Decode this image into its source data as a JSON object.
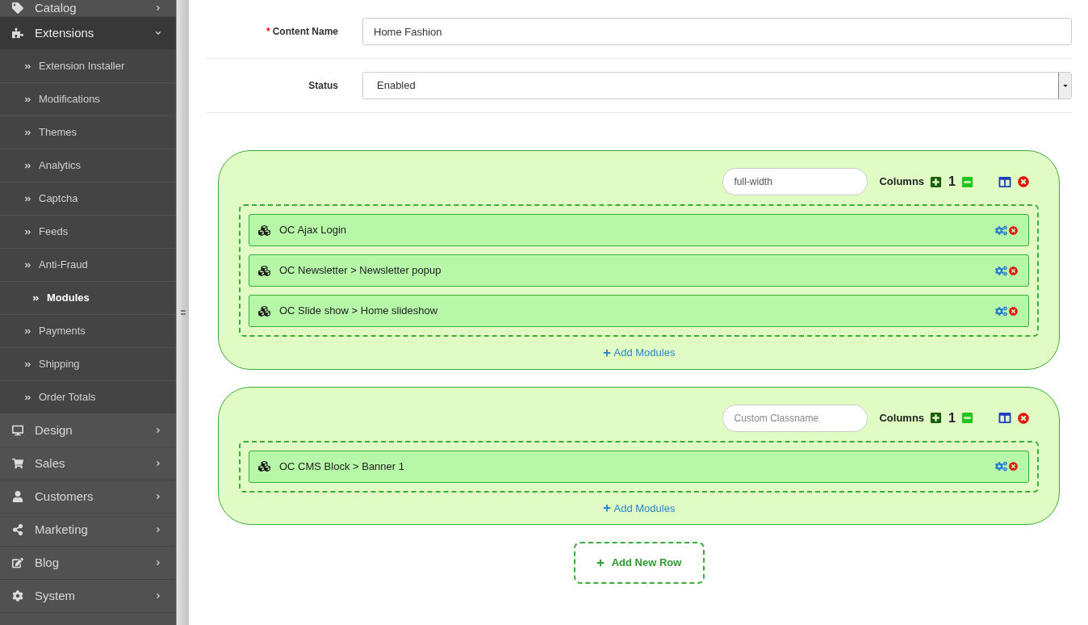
{
  "sidebar": {
    "items": [
      {
        "label": "Catalog",
        "expanded": false
      },
      {
        "label": "Extensions",
        "expanded": true,
        "children": [
          {
            "label": "Extension Installer",
            "selected": false
          },
          {
            "label": "Modifications",
            "selected": false
          },
          {
            "label": "Themes",
            "selected": false
          },
          {
            "label": "Analytics",
            "selected": false
          },
          {
            "label": "Captcha",
            "selected": false
          },
          {
            "label": "Feeds",
            "selected": false
          },
          {
            "label": "Anti-Fraud",
            "selected": false
          },
          {
            "label": "Modules",
            "selected": true
          },
          {
            "label": "Payments",
            "selected": false
          },
          {
            "label": "Shipping",
            "selected": false
          },
          {
            "label": "Order Totals",
            "selected": false
          }
        ]
      },
      {
        "label": "Design",
        "expanded": false
      },
      {
        "label": "Sales",
        "expanded": false
      },
      {
        "label": "Customers",
        "expanded": false
      },
      {
        "label": "Marketing",
        "expanded": false
      },
      {
        "label": "Blog",
        "expanded": false
      },
      {
        "label": "System",
        "expanded": false
      }
    ]
  },
  "form": {
    "fields": [
      {
        "kind": "text",
        "label": "Content Name",
        "required_mark": "*",
        "value": "Home Fashion"
      },
      {
        "kind": "select",
        "label": "Status",
        "value": "Enabled"
      }
    ]
  },
  "layout_rows": [
    {
      "classname": {
        "value": "full-width"
      },
      "columns_label": "Columns",
      "columns": "1",
      "modules": [
        {
          "name": "OC Ajax Login"
        },
        {
          "name": "OC Newsletter > Newsletter popup"
        },
        {
          "name": "OC Slide show > Home slideshow"
        }
      ],
      "add_label": "Add Modules"
    },
    {
      "classname": {
        "placeholder": "Custom Classname"
      },
      "columns_label": "Columns",
      "columns": "1",
      "modules": [
        {
          "name": "OC CMS Block > Banner 1"
        }
      ],
      "add_label": "Add Modules"
    }
  ],
  "add_row_button": "Add New Row"
}
